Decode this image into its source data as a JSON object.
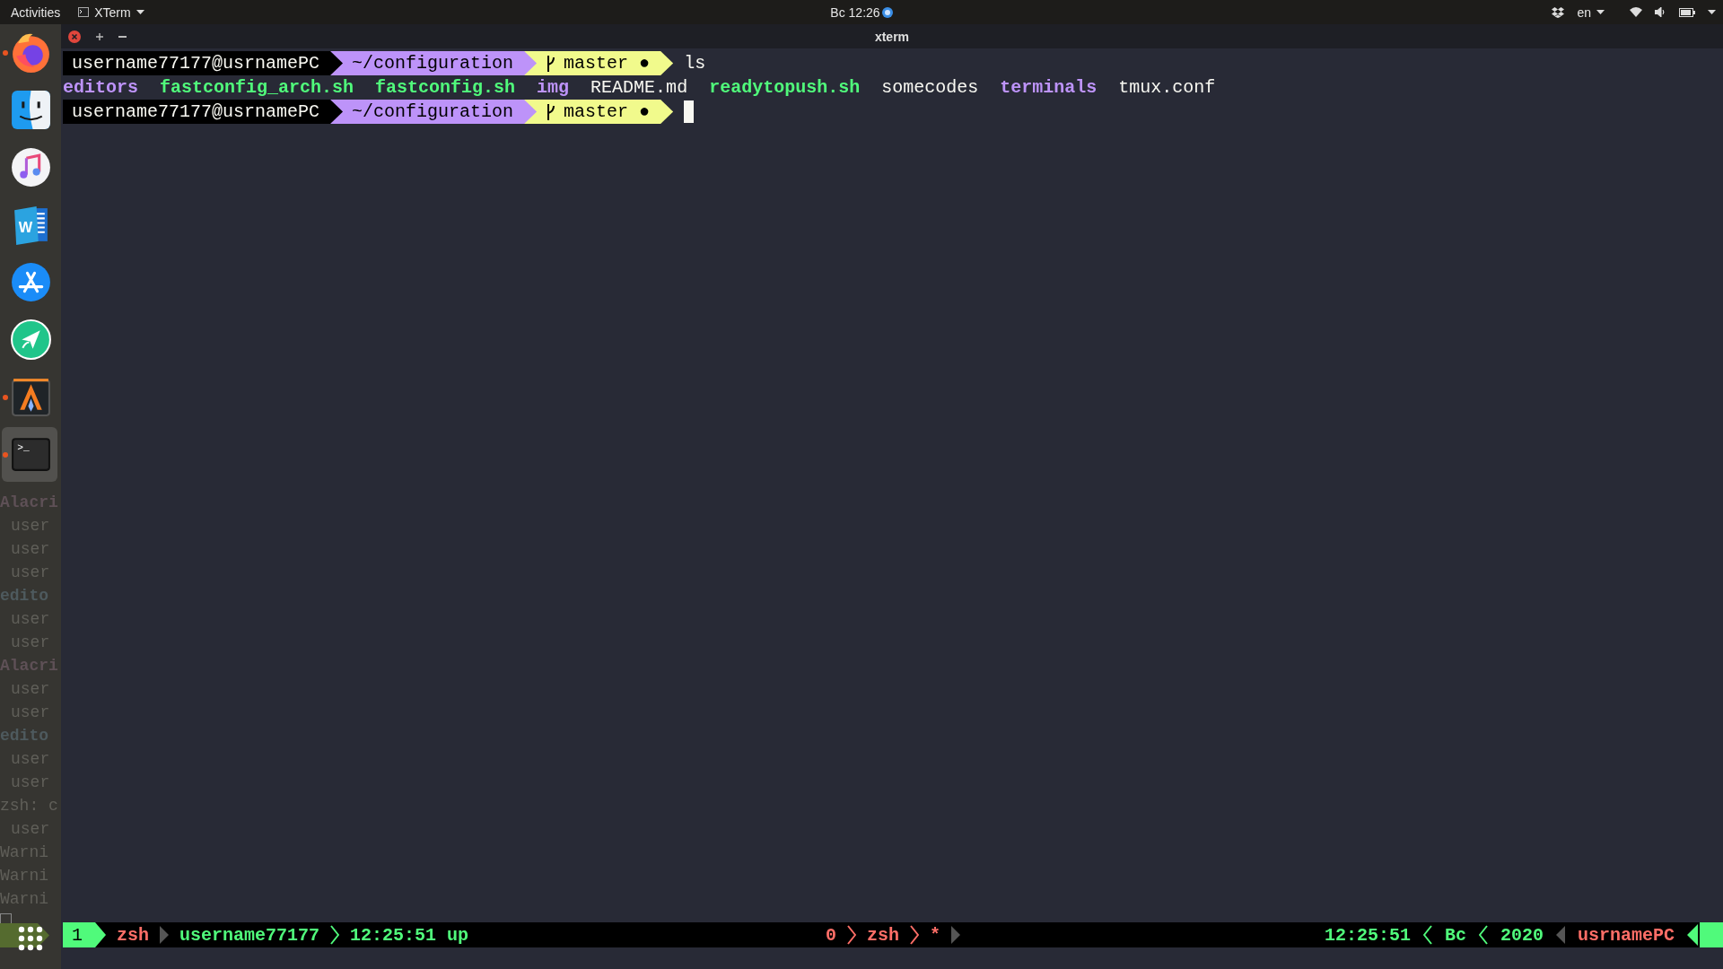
{
  "top_bar": {
    "activities": "Activities",
    "app_menu": "XTerm",
    "clock": "Bc 12:26",
    "language": "en"
  },
  "dock": {
    "items": [
      {
        "kind": "browser",
        "running": true,
        "selected": false
      },
      {
        "kind": "finder",
        "running": false,
        "selected": false
      },
      {
        "kind": "music",
        "running": false,
        "selected": false
      },
      {
        "kind": "writer",
        "label": "W",
        "running": false,
        "selected": false
      },
      {
        "kind": "store",
        "running": false,
        "selected": false
      },
      {
        "kind": "send",
        "running": false,
        "selected": false
      },
      {
        "kind": "alacritty",
        "running": true,
        "selected": false
      },
      {
        "kind": "terminal",
        "label": ">_",
        "running": true,
        "selected": true
      }
    ]
  },
  "background_terminal": {
    "lines": [
      {
        "kind": "heading",
        "text": "Alacri",
        "color": "#5e5056"
      },
      {
        "kind": "output",
        "text": "user"
      },
      {
        "kind": "output",
        "text": "user"
      },
      {
        "kind": "output",
        "text": "user"
      },
      {
        "kind": "heading",
        "text": "edito",
        "color": "#4e5a5e"
      },
      {
        "kind": "output",
        "text": "user"
      },
      {
        "kind": "output",
        "text": "user"
      },
      {
        "kind": "heading",
        "text": "Alacri",
        "color": "#5e5056"
      },
      {
        "kind": "output",
        "text": "user"
      },
      {
        "kind": "output",
        "text": "user"
      },
      {
        "kind": "heading",
        "text": "edito",
        "color": "#4e5a5e"
      },
      {
        "kind": "output",
        "text": "user"
      },
      {
        "kind": "output",
        "text": "user"
      },
      {
        "kind": "message",
        "text": "zsh: c"
      },
      {
        "kind": "output",
        "text": "user"
      },
      {
        "kind": "message",
        "text": "Warni"
      },
      {
        "kind": "message",
        "text": "Warni"
      },
      {
        "kind": "message",
        "text": "Warni"
      }
    ]
  },
  "window": {
    "title": "xterm"
  },
  "terminal": {
    "lines": [
      {
        "kind": "prompt",
        "segments": [
          {
            "kind": "host",
            "text": "username77177@usrnamePC"
          },
          {
            "kind": "path",
            "text": "~/configuration"
          },
          {
            "kind": "git",
            "text": "master",
            "mark": "●"
          }
        ],
        "command": "ls",
        "cursor": false
      },
      {
        "kind": "listing",
        "entries": [
          {
            "kind": "directory",
            "name": "editors"
          },
          {
            "kind": "executable",
            "name": "fastconfig_arch.sh"
          },
          {
            "kind": "executable",
            "name": "fastconfig.sh"
          },
          {
            "kind": "directory",
            "name": "img"
          },
          {
            "kind": "file",
            "name": "README.md"
          },
          {
            "kind": "executable",
            "name": "readytopush.sh"
          },
          {
            "kind": "file",
            "name": "somecodes"
          },
          {
            "kind": "directory",
            "name": "terminals"
          },
          {
            "kind": "file",
            "name": "tmux.conf"
          }
        ]
      },
      {
        "kind": "prompt",
        "segments": [
          {
            "kind": "host",
            "text": "username77177@usrnamePC"
          },
          {
            "kind": "path",
            "text": "~/configuration"
          },
          {
            "kind": "git",
            "text": "master",
            "mark": "●"
          }
        ],
        "cursor": true
      }
    ]
  },
  "status_bar": {
    "left": [
      {
        "kind": "index",
        "text": "1",
        "color": "#50fa7b"
      },
      {
        "kind": "text",
        "text": "zsh",
        "color": "#ff6e67"
      },
      {
        "kind": "arrow-right",
        "color": "#555555"
      },
      {
        "kind": "text",
        "text": "username77177",
        "color": "#50fa7b"
      },
      {
        "kind": "chevron-right",
        "color": "#50fa7b"
      },
      {
        "kind": "text",
        "text": "12:25:51 up",
        "color": "#50fa7b"
      }
    ],
    "center": [
      {
        "kind": "text",
        "text": "0",
        "color": "#ff6e67"
      },
      {
        "kind": "chevron-right",
        "color": "#ff6e67"
      },
      {
        "kind": "text",
        "text": "zsh",
        "color": "#ff6e67"
      },
      {
        "kind": "chevron-right",
        "color": "#ff6e67"
      },
      {
        "kind": "text",
        "text": "*",
        "color": "#ff6e67"
      },
      {
        "kind": "arrow-right",
        "color": "#555555"
      }
    ],
    "right": [
      {
        "kind": "text",
        "text": "12:25:51",
        "color": "#50fa7b"
      },
      {
        "kind": "chevron-left",
        "color": "#50fa7b"
      },
      {
        "kind": "text",
        "text": "Bc",
        "color": "#50fa7b"
      },
      {
        "kind": "chevron-left",
        "color": "#50fa7b"
      },
      {
        "kind": "text",
        "text": "2020",
        "color": "#50fa7b"
      },
      {
        "kind": "arrow-left",
        "color": "#555555"
      },
      {
        "kind": "text",
        "text": "usrnamePC",
        "color": "#ff6e67"
      },
      {
        "kind": "end-cap",
        "color": "#50fa7b"
      }
    ]
  }
}
